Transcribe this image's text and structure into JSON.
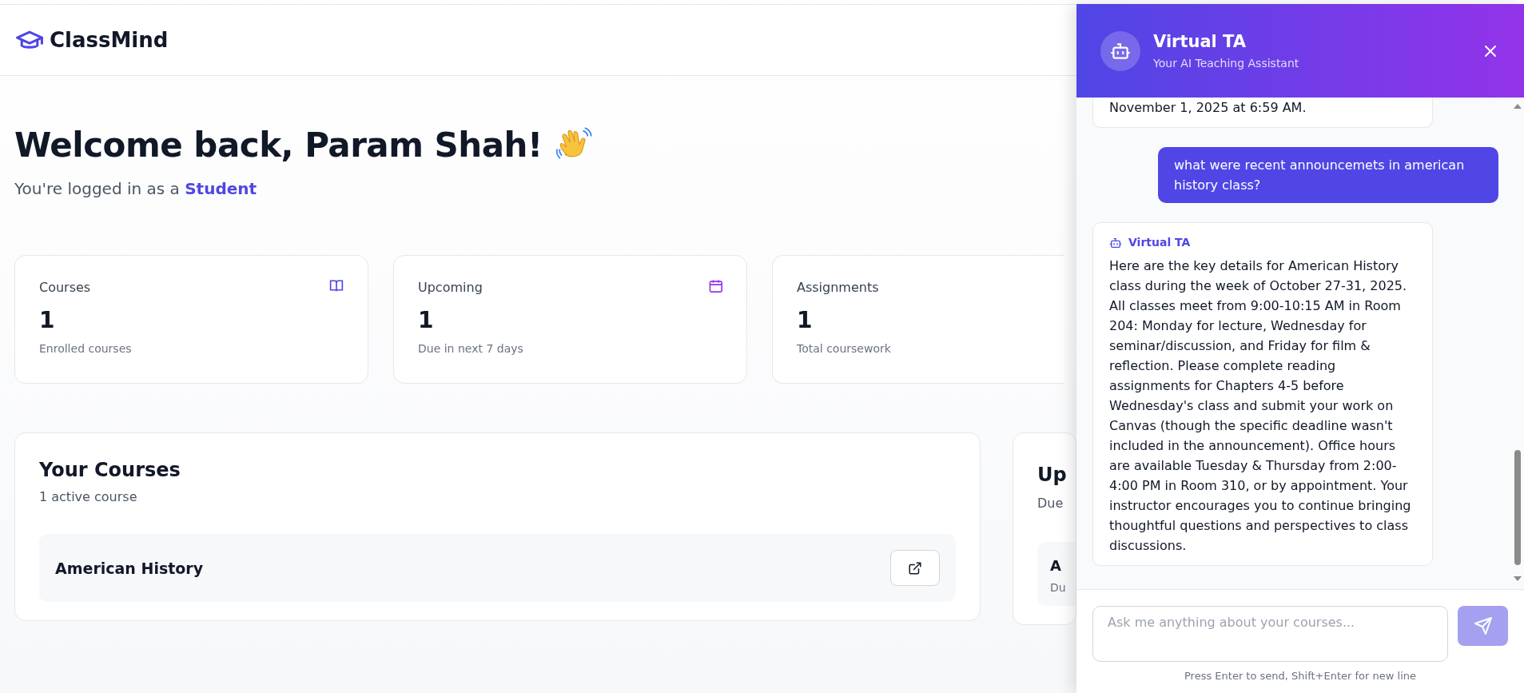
{
  "app": {
    "name": "ClassMind"
  },
  "welcome": {
    "heading": "Welcome back, Param Shah!",
    "subtitle": "You're logged in as a **Student**"
  },
  "stats": [
    {
      "label": "Courses",
      "value": "1",
      "caption": "Enrolled courses"
    },
    {
      "label": "Upcoming",
      "value": "1",
      "caption": "Due in next 7 days"
    },
    {
      "label": "Assignments",
      "value": "1",
      "caption": "Total coursework"
    }
  ],
  "courses": {
    "title": "Your Courses",
    "subtitle": "1 active course",
    "items": [
      {
        "name": "American History"
      }
    ]
  },
  "upcoming": {
    "title": "Up",
    "subtitle": "Due",
    "items": [
      {
        "name": "A",
        "due": "Du"
      }
    ]
  },
  "chat": {
    "title": "Virtual TA",
    "subtitle": "Your AI Teaching Assistant",
    "messages": [
      {
        "kind": "assistant",
        "text": "November 1, 2025 at 6:59 AM."
      },
      {
        "kind": "user",
        "text": "what were recent announcemets in american history class?"
      },
      {
        "kind": "assistant",
        "sender": "Virtual TA",
        "text": "Here are the key details for American History class during the week of October 27-31, 2025. All classes meet from 9:00-10:15 AM in Room 204: Monday for lecture, Wednesday for seminar/discussion, and Friday for film & reflection. Please complete reading assignments for Chapters 4-5 before Wednesday's class and submit your work on Canvas (though the specific deadline wasn't included in the announcement). Office hours are available Tuesday & Thursday from 2:00-4:00 PM in Room 310, or by appointment. Your instructor encourages you to continue bringing thoughtful questions and perspectives to class discussions."
      }
    ],
    "input": {
      "placeholder": "Ask me anything about your courses..."
    },
    "hint": "Press Enter to send, Shift+Enter for new line"
  }
}
